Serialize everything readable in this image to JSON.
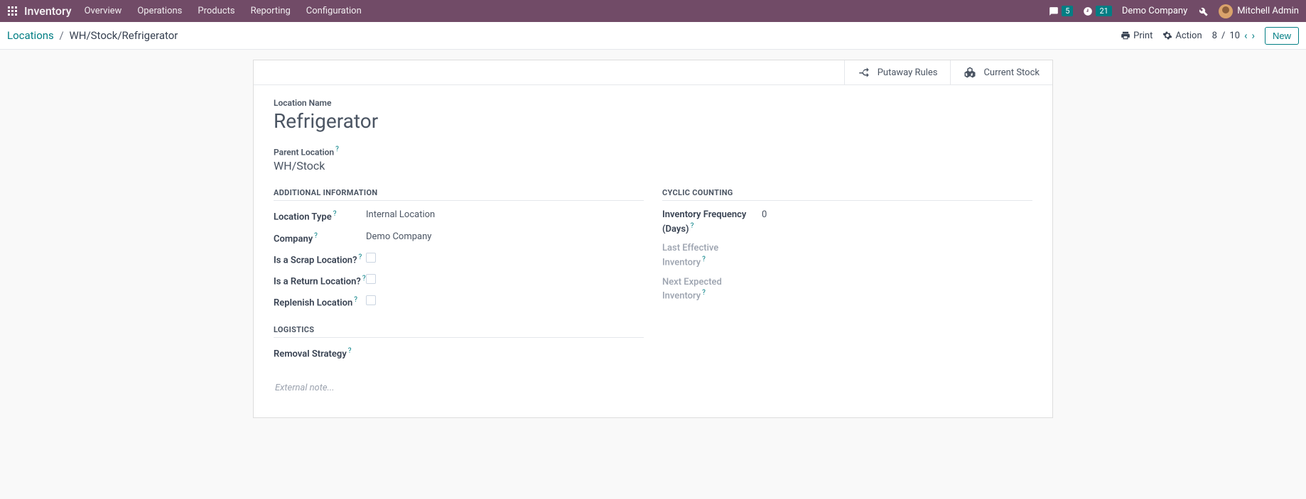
{
  "topbar": {
    "brand": "Inventory",
    "menu": [
      "Overview",
      "Operations",
      "Products",
      "Reporting",
      "Configuration"
    ],
    "chat_count": "5",
    "activity_count": "21",
    "company": "Demo Company",
    "user": "Mitchell Admin"
  },
  "control_panel": {
    "breadcrumb_root": "Locations",
    "breadcrumb_current": "WH/Stock/Refrigerator",
    "print": "Print",
    "action": "Action",
    "pager_pos": "8",
    "pager_total": "10",
    "pager_sep": " / ",
    "new_btn": "New"
  },
  "stat_buttons": {
    "putaway": "Putaway Rules",
    "stock": "Current Stock"
  },
  "form": {
    "location_name_label": "Location Name",
    "location_name": "Refrigerator",
    "parent_label": "Parent Location",
    "parent_value": "WH/Stock",
    "sections": {
      "additional": "ADDITIONAL INFORMATION",
      "logistics": "LOGISTICS",
      "cyclic": "CYCLIC COUNTING"
    },
    "additional": {
      "location_type_label": "Location Type",
      "location_type": "Internal Location",
      "company_label": "Company",
      "company": "Demo Company",
      "scrap_label": "Is a Scrap Location?",
      "return_label": "Is a Return Location?",
      "replenish_label": "Replenish Location"
    },
    "logistics": {
      "removal_label": "Removal Strategy"
    },
    "cyclic": {
      "freq_label": "Inventory Frequency (Days)",
      "freq_value": "0",
      "last_label": "Last Effective Inventory",
      "next_label": "Next Expected Inventory"
    },
    "external_note_placeholder": "External note..."
  },
  "help_mark": "?"
}
